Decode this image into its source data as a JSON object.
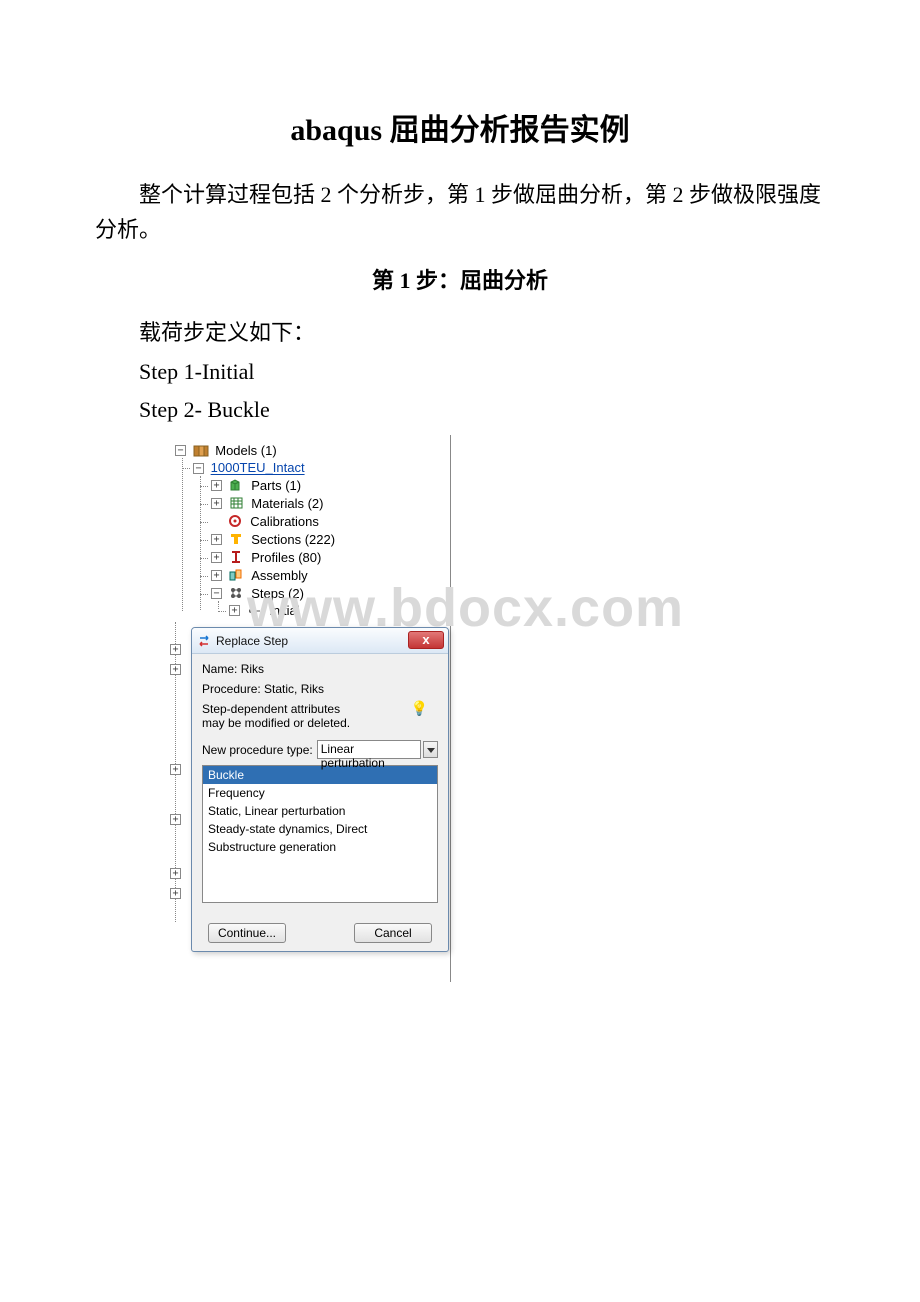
{
  "title": "abaqus 屈曲分析报告实例",
  "intro": "整个计算过程包括 2 个分析步，第 1 步做屈曲分析，第 2 步做极限强度分析。",
  "sub1": "第 1 步：屈曲分析",
  "loaddef": "载荷步定义如下：",
  "step1": "Step 1-Initial",
  "step2": "Step 2- Buckle",
  "watermark": "www.bdocx.com",
  "tree": {
    "models": "Models (1)",
    "model_name": "1000TEU_Intact",
    "parts": "Parts (1)",
    "materials": "Materials (2)",
    "calibrations": "Calibrations",
    "sections": "Sections (222)",
    "profiles": "Profiles (80)",
    "assembly": "Assembly",
    "steps": "Steps (2)",
    "initial": "Initial"
  },
  "dialog": {
    "title": "Replace Step",
    "name_label": "Name:",
    "name_value": "Riks",
    "proc_label": "Procedure:",
    "proc_value": "Static, Riks",
    "hint1": "Step-dependent attributes",
    "hint2": "may be modified or deleted.",
    "newproc_label": "New procedure type:",
    "newproc_value": "Linear perturbation",
    "options": {
      "buckle": "Buckle",
      "frequency": "Frequency",
      "static_lp": "Static, Linear perturbation",
      "steady": "Steady-state dynamics, Direct",
      "substructure": "Substructure generation"
    },
    "continue": "Continue...",
    "cancel": "Cancel",
    "close": "x"
  }
}
